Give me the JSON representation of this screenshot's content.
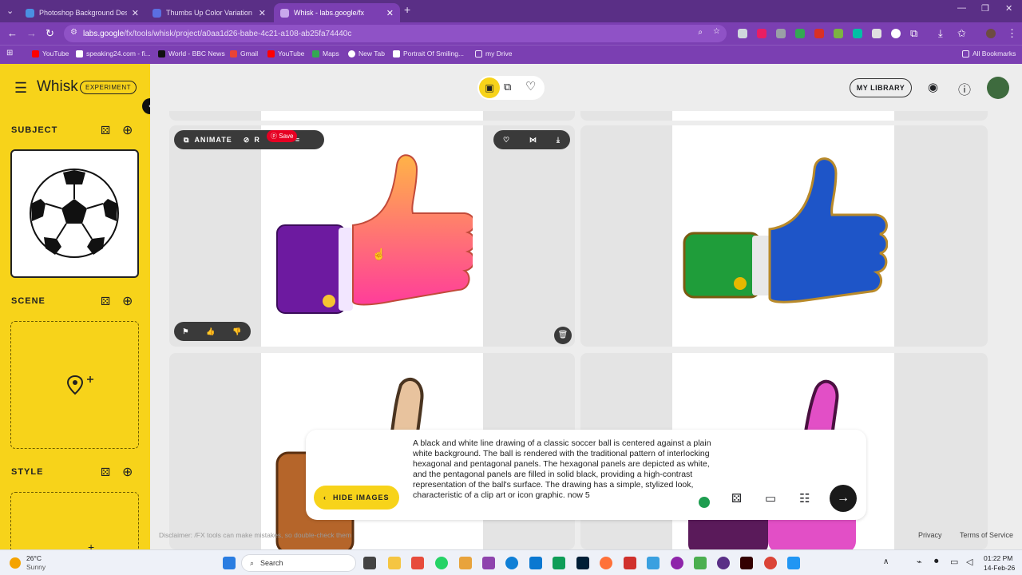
{
  "browser": {
    "tabs": [
      {
        "title": "Photoshop Background Design",
        "color": "#4a90e2"
      },
      {
        "title": "Thumbs Up Color Variation Pro",
        "color": "#5b6ee1"
      },
      {
        "title": "Whisk - labs.google/fx",
        "color": "#7b3fb2"
      }
    ],
    "url_domain": "labs.google",
    "url_path": "/fx/tools/whisk/project/a0aa1d26-babe-4c21-a108-ab25fa74440c",
    "bookmarks": [
      "YouTube",
      "speaking24.com - fi...",
      "World - BBC News",
      "Gmail",
      "YouTube",
      "Maps",
      "New Tab",
      "Portrait Of Smiling...",
      "my Drive"
    ],
    "all_bookmarks": "All Bookmarks"
  },
  "app": {
    "title": "Whisk",
    "badge": "EXPERIMENT",
    "sections": {
      "subject": "SUBJECT",
      "scene": "SCENE",
      "style": "STYLE"
    },
    "library_button": "MY LIBRARY",
    "tile_actions": {
      "animate": "ANIMATE",
      "refine": "R",
      "save": "Save"
    },
    "hide_images": "HIDE IMAGES",
    "prompt_text": "A black and white line drawing of a classic soccer ball is centered against a plain white background. The ball is rendered with the traditional pattern of interlocking hexagonal and pentagonal panels. The hexagonal panels are depicted as white, and the pentagonal panels are filled in solid black, providing a high-contrast representation of the ball's surface. The drawing has a simple, stylized look, characteristic of a clip art or icon graphic. now 5",
    "disclaimer": "Disclaimer: /FX tools can make mistakes, so double-check them",
    "footer_links": [
      "Privacy",
      "Terms of Service"
    ],
    "accent": "#f7d31a"
  },
  "taskbar": {
    "weather_temp": "26°C",
    "weather_desc": "Sunny",
    "search": "Search",
    "time": "01:22 PM",
    "date": "14-Feb-26"
  }
}
